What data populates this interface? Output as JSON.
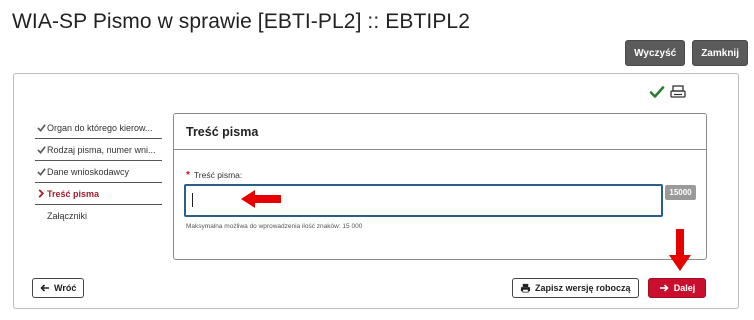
{
  "page": {
    "title": "WIA-SP Pismo w sprawie [EBTI-PL2] :: EBTIPL2"
  },
  "top_actions": {
    "clear_label": "Wyczyść",
    "close_label": "Zamknij"
  },
  "wizard": {
    "steps": [
      {
        "label": "Organ do którego kierow...",
        "state": "done"
      },
      {
        "label": "Rodzaj pisma, numer wni...",
        "state": "done"
      },
      {
        "label": "Dane wnioskodawcy",
        "state": "done"
      },
      {
        "label": "Treść pisma",
        "state": "active"
      },
      {
        "label": "Załączniki",
        "state": "pending"
      }
    ]
  },
  "panel": {
    "title": "Treść pisma",
    "field_label": "Treść pisma:",
    "required_mark": "*",
    "input_value": "",
    "char_counter": "15000",
    "help_text": "Maksymalna możliwa do wprowadzenia ilość znaków: 15 000"
  },
  "footer": {
    "back_label": "Wróć",
    "draft_label": "Zapisz wersję roboczą",
    "next_label": "Dalej"
  },
  "colors": {
    "accent_red": "#c8102e",
    "check_green": "#2e7d32",
    "dark_button": "#5a5a5a",
    "input_border": "#2b5f8a",
    "annotation_arrow": "#e60000"
  },
  "icons": {
    "status": "check-icon",
    "print": "print-icon",
    "back": "arrow-left-icon",
    "draft": "print-icon",
    "next": "arrow-right-icon"
  }
}
